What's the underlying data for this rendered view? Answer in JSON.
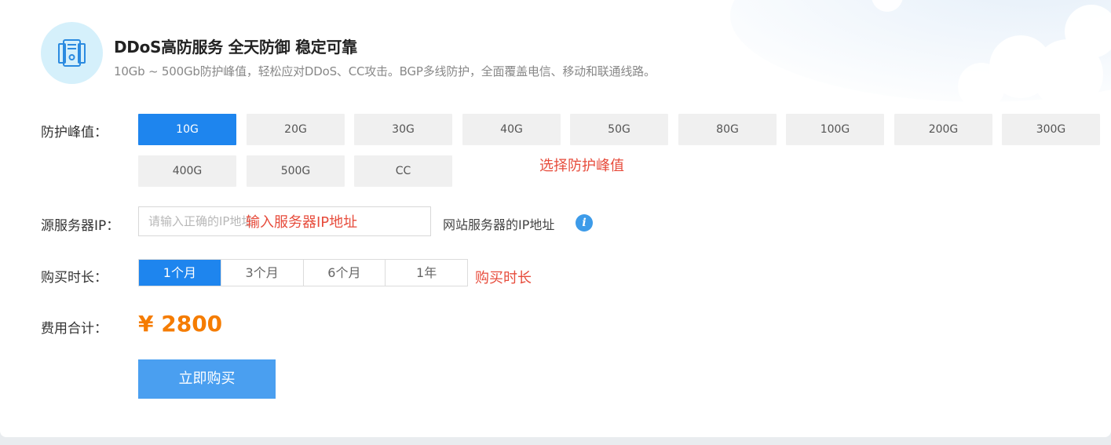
{
  "header": {
    "icon": "server-shield-icon",
    "title": "DDoS高防服务 全天防御 稳定可靠",
    "subtitle": "10Gb ~ 500Gb防护峰值，轻松应对DDoS、CC攻击。BGP多线防护，全面覆盖电信、移动和联通线路。"
  },
  "protection": {
    "label": "防护峰值：",
    "options": [
      "10G",
      "20G",
      "30G",
      "40G",
      "50G",
      "80G",
      "100G",
      "200G",
      "300G",
      "400G",
      "500G",
      "CC"
    ],
    "selected": "10G",
    "annotation": "选择防护峰值"
  },
  "ip": {
    "label": "源服务器IP：",
    "placeholder": "请输入正确的IP地址",
    "annotation": "输入服务器IP地址",
    "hint": "网站服务器的IP地址",
    "hint_icon": "info-icon"
  },
  "duration": {
    "label": "购买时长：",
    "options": [
      "1个月",
      "3个月",
      "6个月",
      "1年"
    ],
    "selected": "1个月",
    "annotation": "购买时长"
  },
  "total": {
    "label": "费用合计：",
    "price": "¥ 2800"
  },
  "buy_button": "立即购买",
  "colors": {
    "accent": "#1e85ee",
    "price": "#f57c00",
    "annotation": "#e74c3c",
    "button": "#4a9ff0"
  }
}
